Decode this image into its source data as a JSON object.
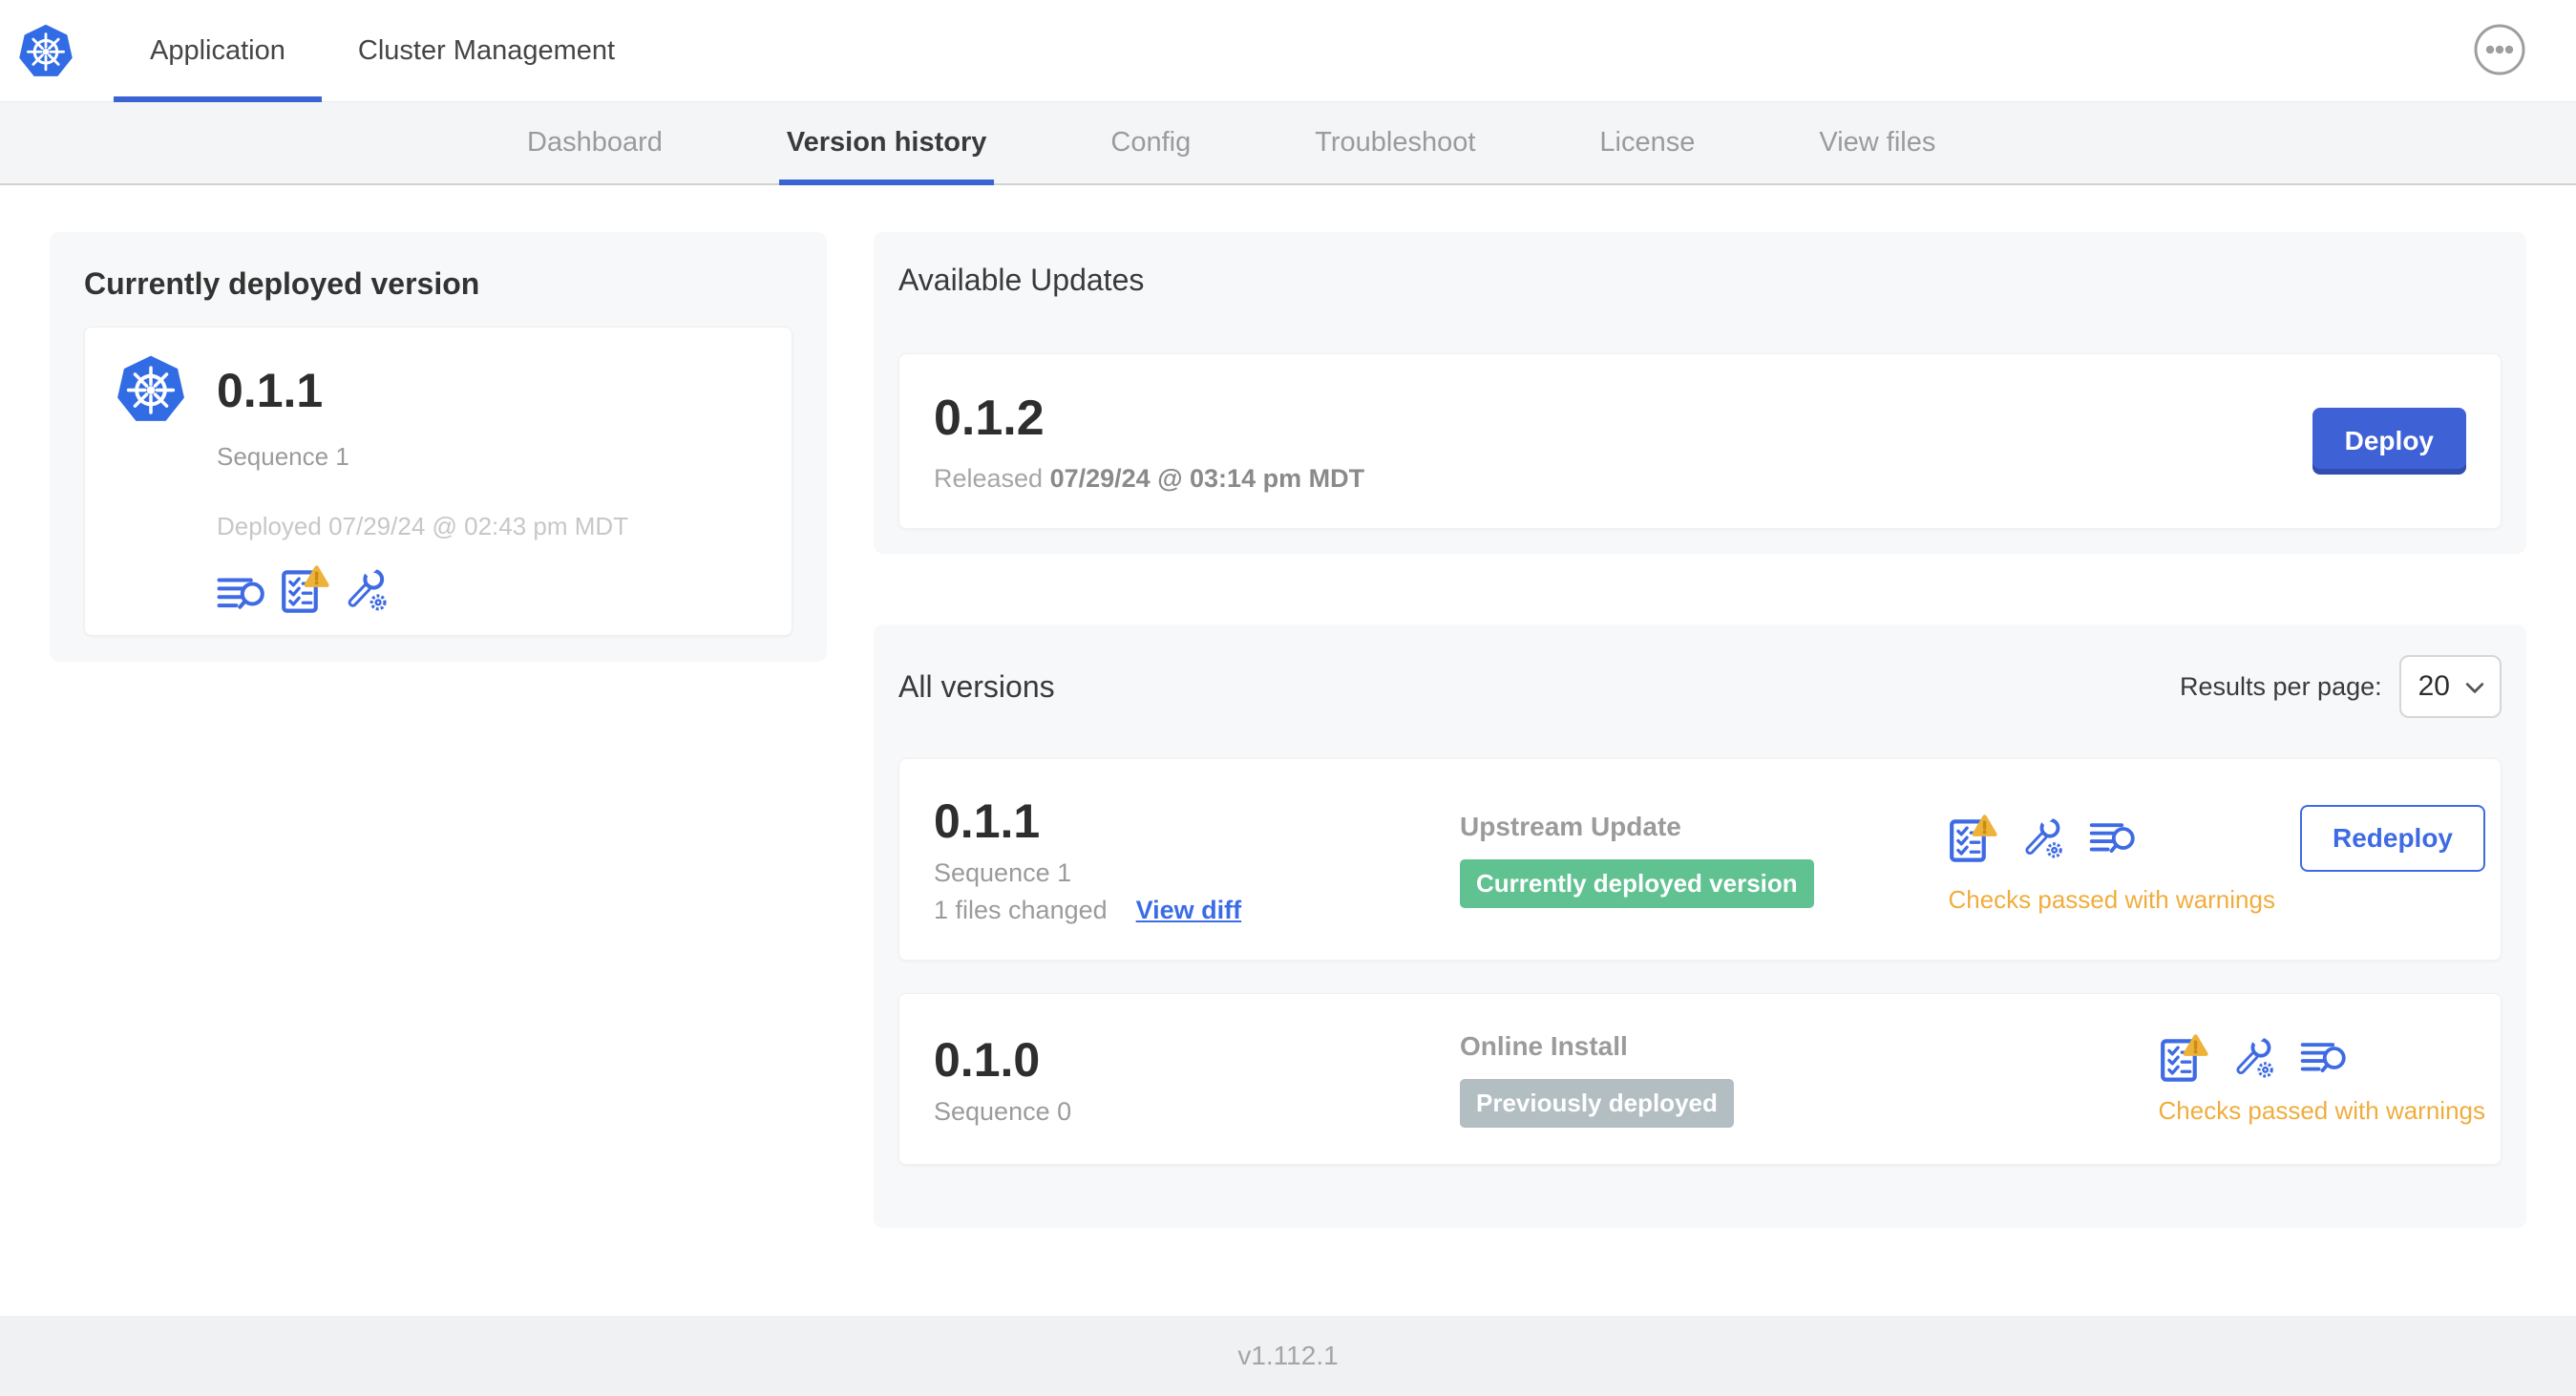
{
  "header": {
    "tabs": [
      "Application",
      "Cluster Management"
    ],
    "active_tab": "Application"
  },
  "subnav": {
    "tabs": [
      "Dashboard",
      "Version history",
      "Config",
      "Troubleshoot",
      "License",
      "View files"
    ],
    "active_tab": "Version history"
  },
  "currently_deployed": {
    "title": "Currently deployed version",
    "version": "0.1.1",
    "sequence": "Sequence 1",
    "deployed_at": "Deployed 07/29/24 @ 02:43 pm MDT"
  },
  "available_updates": {
    "title": "Available Updates",
    "version": "0.1.2",
    "released_label": "Released",
    "released_at": "07/29/24 @ 03:14 pm MDT",
    "deploy_button": "Deploy"
  },
  "all_versions": {
    "title": "All versions",
    "results_per_page_label": "Results per page:",
    "results_per_page": "20",
    "rows": [
      {
        "version": "0.1.1",
        "sequence": "Sequence 1",
        "files_changed": "1 files changed",
        "view_diff": "View diff",
        "source": "Upstream Update",
        "badge": "Currently deployed version",
        "badge_color": "#61C291",
        "action": "Redeploy",
        "status": "Checks passed with warnings"
      },
      {
        "version": "0.1.0",
        "sequence": "Sequence 0",
        "source": "Online Install",
        "badge": "Previously deployed",
        "badge_color": "#B3BEC2",
        "status": "Checks passed with warnings"
      }
    ]
  },
  "footer": {
    "app_version": "v1.112.1"
  },
  "icons": {
    "logo": "kubernetes-logo",
    "overflow": "ellipsis-menu",
    "release_notes": "lines-with-magnifier",
    "preflight": "checklist-with-warning-triangle",
    "config": "wrench-with-gear",
    "select_chevron": "chevron-down"
  },
  "colors": {
    "kubernetes_blue": "#326CE5",
    "accent_blue": "#3E6BE4",
    "nav_underline_blue": "#3B63D3",
    "deploy_button_blue": "#3E61D6",
    "badge_green": "#61C291",
    "badge_gray": "#B3BEC2",
    "warning_orange": "#F0AD3D",
    "triangle_amber": "#EDB23A",
    "card_gray": "#F7F8FA",
    "subnav_gray": "#F4F5F7",
    "footer_gray": "#F0F1F2"
  }
}
